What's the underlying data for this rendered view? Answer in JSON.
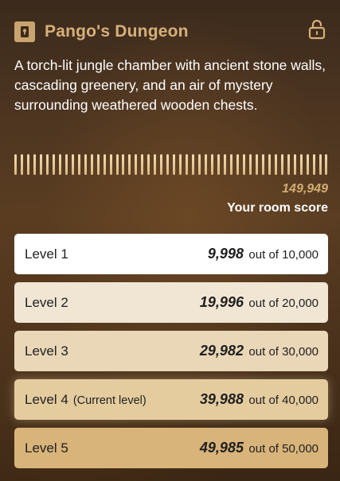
{
  "header": {
    "title": "Pango's Dungeon",
    "badge_icon": "lock-icon",
    "lock_button_icon": "unlock-icon",
    "accent_color": "#d6b07a"
  },
  "description": "A torch-lit jungle chamber with ancient stone walls, cascading greenery, and an air of mystery surrounding weathered wooden chests.",
  "room_score": {
    "value": "149,949",
    "label": "Your room score"
  },
  "levels": [
    {
      "name": "Level 1",
      "current_tag": "",
      "score": "9,998",
      "out_of": "out of 10,000"
    },
    {
      "name": "Level 2",
      "current_tag": "",
      "score": "19,996",
      "out_of": "out of 20,000"
    },
    {
      "name": "Level 3",
      "current_tag": "",
      "score": "29,982",
      "out_of": "out of 30,000"
    },
    {
      "name": "Level 4",
      "current_tag": "(Current level)",
      "score": "39,988",
      "out_of": "out of 40,000"
    },
    {
      "name": "Level 5",
      "current_tag": "",
      "score": "49,985",
      "out_of": "out of 50,000"
    }
  ]
}
